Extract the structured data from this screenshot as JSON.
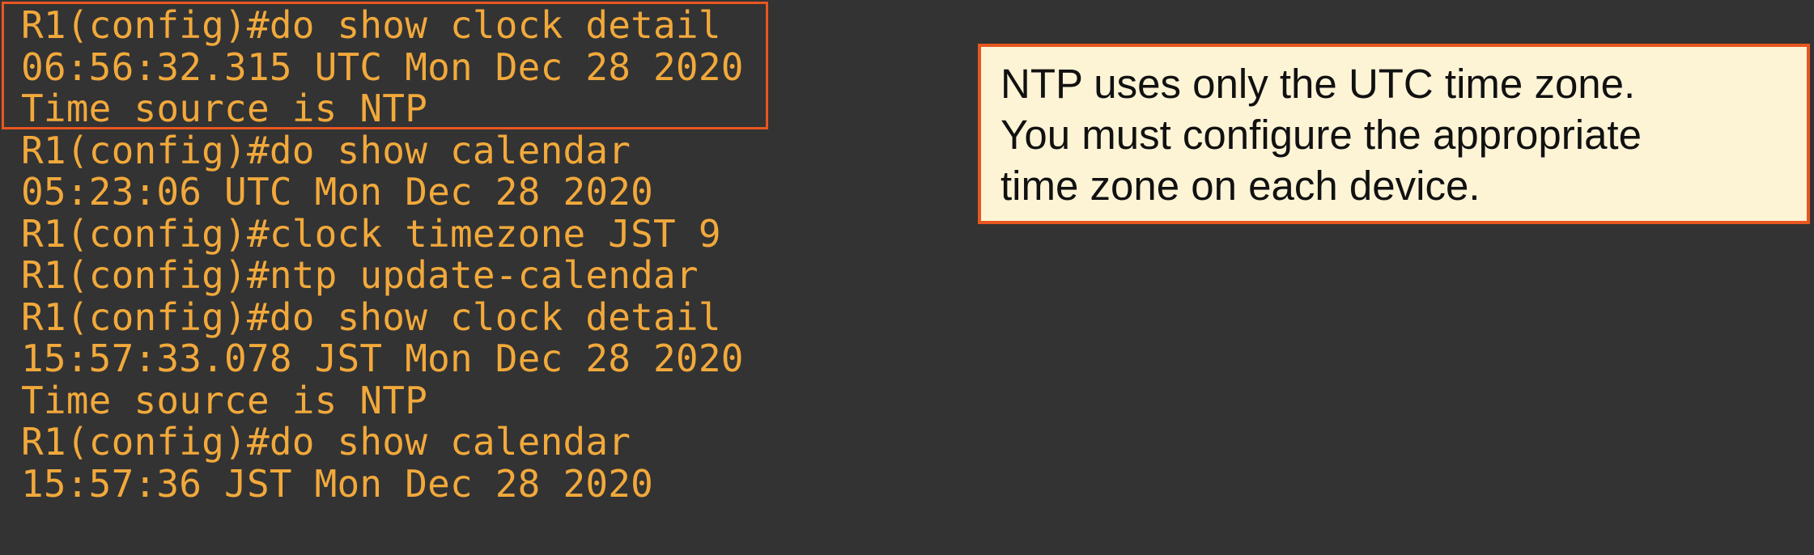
{
  "terminal": {
    "lines": [
      "R1(config)#do show clock detail",
      "06:56:32.315 UTC Mon Dec 28 2020",
      "Time source is NTP",
      "R1(config)#do show calendar",
      "05:23:06 UTC Mon Dec 28 2020",
      "R1(config)#clock timezone JST 9",
      "R1(config)#ntp update-calendar",
      "R1(config)#do show clock detail",
      "15:57:33.078 JST Mon Dec 28 2020",
      "Time source is NTP",
      "R1(config)#do show calendar",
      "15:57:36 JST Mon Dec 28 2020"
    ]
  },
  "callout": {
    "lines": [
      "NTP uses only the UTC time zone.",
      "You must configure the appropriate",
      "time zone on each device."
    ]
  },
  "colors": {
    "background": "#333333",
    "terminal_text": "#f2a93b",
    "highlight_border": "#e8571f",
    "callout_background": "#fdf4d6",
    "callout_text": "#111111"
  }
}
